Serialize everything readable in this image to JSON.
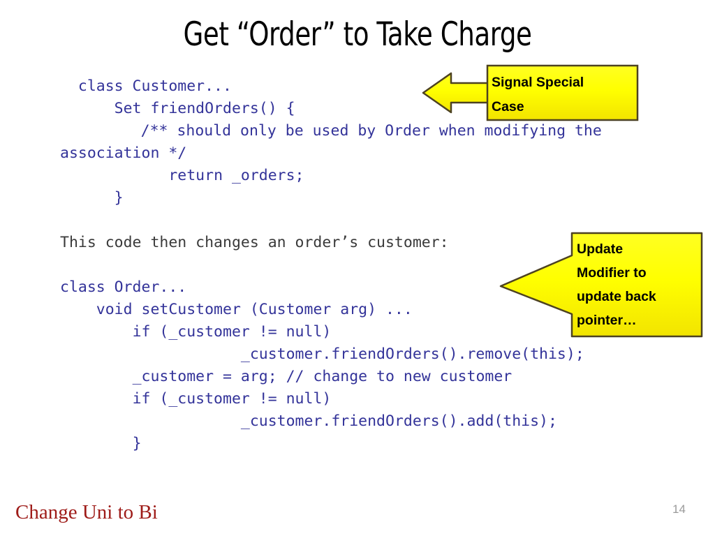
{
  "slide": {
    "title": "Get “Order” to Take Charge",
    "page_number": "14",
    "footer_note": "Change Uni to Bi",
    "colors": {
      "code_blue": "#333399",
      "code_dark": "#3a3a3a",
      "callout_fill": "#ffff00",
      "callout_border": "#4d4221",
      "footer_red": "#9e1b18",
      "page_number_gray": "#9a9a9a",
      "background": "#ffffff"
    }
  },
  "code": {
    "lines": [
      {
        "text": "  class Customer...",
        "style": "blue"
      },
      {
        "text": "      Set friendOrders() {",
        "style": "blue"
      },
      {
        "text": "      /** should only be used by Order when modifying the association */",
        "style": "blue-wrap"
      },
      {
        "text": "            return _orders;",
        "style": "blue"
      },
      {
        "text": "      }",
        "style": "blue"
      },
      {
        "text": "",
        "style": "blank"
      },
      {
        "text": "This code then changes an order’s customer:",
        "style": "dark"
      },
      {
        "text": "",
        "style": "blank"
      },
      {
        "text": "class Order...",
        "style": "blue"
      },
      {
        "text": "    void setCustomer (Customer arg) ...",
        "style": "blue"
      },
      {
        "text": "        if (_customer != null)",
        "style": "blue"
      },
      {
        "text": "                    _customer.friendOrders().remove(this);",
        "style": "blue"
      },
      {
        "text": "        _customer = arg; // change to new customer",
        "style": "blue"
      },
      {
        "text": "        if (_customer != null)",
        "style": "blue"
      },
      {
        "text": "                    _customer.friendOrders().add(this);",
        "style": "blue"
      },
      {
        "text": "        }",
        "style": "blue"
      }
    ]
  },
  "callouts": [
    {
      "id": "signal-special-case",
      "shape": "left-arrow-box",
      "lines": [
        "Signal Special",
        "Case"
      ],
      "text": "Signal Special Case"
    },
    {
      "id": "update-modifier",
      "shape": "speech-bubble-left",
      "lines": [
        "Update",
        "Modifier to",
        "update back",
        "pointer…"
      ],
      "text": "Update Modifier to update back pointer…"
    }
  ]
}
